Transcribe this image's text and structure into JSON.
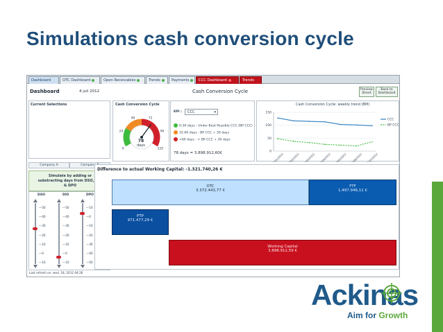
{
  "slide": {
    "title": "Simulations cash conversion cycle"
  },
  "tabs": [
    {
      "label": "Dashboard"
    },
    {
      "label": "OTC Dashboard"
    },
    {
      "label": "Open Receivables"
    },
    {
      "label": "Trends"
    },
    {
      "label": "Payments"
    },
    {
      "label": "CCC Dashboard"
    },
    {
      "label": "Trends"
    }
  ],
  "header": {
    "title": "Dashboard",
    "date": "4 juli 2012",
    "center_title": "Cash Conversion Cycle",
    "preview_button": "Preview Sheet",
    "back_button": "Back to Dashboard"
  },
  "left": {
    "current_selections_title": "Current Selections",
    "company_a": "Company A",
    "company_b": "Company B",
    "simulate_text": "Simulate by adding or substracting days from DSO, DIO & DPO",
    "cols": [
      {
        "label": "DSO",
        "ticks": [
          "—50",
          "—40",
          "—30",
          "—20",
          "—10",
          "—0",
          "—10"
        ]
      },
      {
        "label": "DIO",
        "ticks": [
          "—50",
          "—40",
          "—30",
          "—20",
          "—10",
          "—0",
          "—10"
        ]
      },
      {
        "label": "DPO",
        "ticks": [
          "—10",
          "—0",
          "—10",
          "—20",
          "—30",
          "—40",
          "—50"
        ]
      }
    ],
    "last_refresh": "Last refresh on: wed. 18, 2012 04:26"
  },
  "gauge": {
    "title": "Cash Conversion Cycle",
    "ticks": [
      "0",
      "24",
      "48",
      "72",
      "96",
      "120"
    ],
    "value_number": "78",
    "value_unit": "days",
    "value": 78,
    "max": 120
  },
  "kpi": {
    "label": "KPI :",
    "selected": "CCC",
    "legend": [
      {
        "text": "0-30 days : Under Best Possible CCC (BP CCC)",
        "color": "#3dbb3d"
      },
      {
        "text": "31-60 days : BP CCC + 30 days",
        "color": "#f08a24"
      },
      {
        "text": ">60 days : > BP CCC + 30 days",
        "color": "#d0202a"
      }
    ],
    "summary": "78 days = 3.898.912,60€"
  },
  "trend": {
    "title": "Cash Conversion Cycle: weekly trend (BM)",
    "legend": [
      "CCC",
      "BP CCC"
    ],
    "colors": {
      "ccc": "#2f7fc2",
      "bp": "#3dbb3d"
    },
    "y_ticks": [
      "150",
      "100",
      "50",
      "0"
    ],
    "x_ticks": [
      "1/01/2012",
      "1/02/2012",
      "1/03/2012",
      "1/04/2012",
      "1/05/2012",
      "1/06/2012",
      "1/07/2012"
    ]
  },
  "chart_data": {
    "type": "line",
    "title": "Cash Conversion Cycle: weekly trend (BM)",
    "ylim": [
      0,
      150
    ],
    "x": [
      "1/01/2012",
      "1/02/2012",
      "1/03/2012",
      "1/04/2012",
      "1/05/2012",
      "1/06/2012",
      "1/07/2012"
    ],
    "series": [
      {
        "name": "CCC",
        "values": [
          128,
          117,
          115,
          113,
          103,
          101,
          98
        ]
      },
      {
        "name": "BP CCC",
        "values": [
          48,
          38,
          33,
          26,
          23,
          20,
          36
        ]
      }
    ]
  },
  "diff": {
    "title": "Difference to actual Working Capital: -1.321.740,26 €",
    "otc_label": "OTC",
    "otc_value": "3.372.443,77 €",
    "ftf_label": "FTF",
    "ftf_value": "1.497.946,11 €",
    "ptp_label": "PTP",
    "ptp_value": "971.477,29 €",
    "wc_label": "Working Capital",
    "wc_value": "3.898.912,59 €"
  },
  "logo": {
    "word": "Ackinas",
    "tag_a": "Aim for ",
    "tag_b": "Growth"
  },
  "colors": {
    "title": "#1f4e79",
    "accent_green": "#5aa83b",
    "red_tab": "#c0141d",
    "otc_fill": "#bfe0ff",
    "ftf_fill": "#0a5cb0",
    "ptp_fill": "#0a4fa0",
    "wc_fill": "#c8101e"
  }
}
